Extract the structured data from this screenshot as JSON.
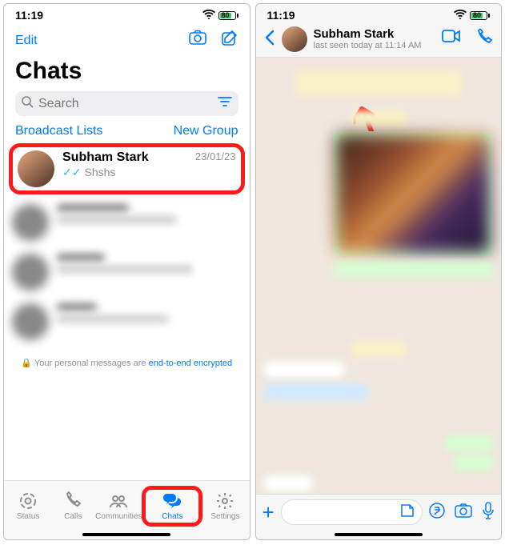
{
  "status": {
    "time": "11:19",
    "battery_pct": "80"
  },
  "left": {
    "edit": "Edit",
    "title": "Chats",
    "search_placeholder": "Search",
    "broadcast": "Broadcast Lists",
    "newgroup": "New Group",
    "highlighted_chat": {
      "name": "Subham Stark",
      "msg": "Shshs",
      "date": "23/01/23"
    },
    "e2e_lead": "Your personal messages are ",
    "e2e_link": "end-to-end encrypted",
    "tabs": {
      "status": "Status",
      "calls": "Calls",
      "communities": "Communities",
      "chats": "Chats",
      "settings": "Settings"
    }
  },
  "right": {
    "name": "Subham Stark",
    "lastseen": "last seen today at 11:14 AM"
  }
}
